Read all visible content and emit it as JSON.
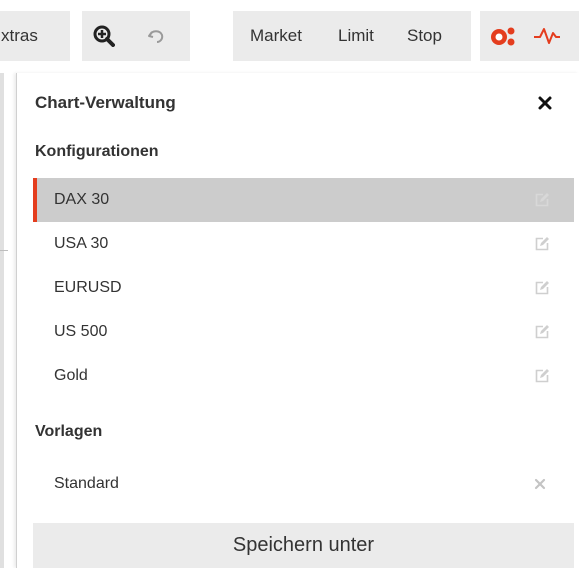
{
  "toolbar": {
    "extras_label": "xtras",
    "market_label": "Market",
    "limit_label": "Limit",
    "stop_label": "Stop"
  },
  "colors": {
    "accent": "#e43d1e",
    "selected_bg": "#cccccc",
    "toolbar_bg": "#ebebeb"
  },
  "panel": {
    "title": "Chart-Verwaltung",
    "configurations_heading": "Konfigurationen",
    "configurations": [
      {
        "label": "DAX 30",
        "selected": true
      },
      {
        "label": "USA 30"
      },
      {
        "label": "EURUSD"
      },
      {
        "label": "US 500"
      },
      {
        "label": "Gold"
      }
    ],
    "templates_heading": "Vorlagen",
    "templates": [
      {
        "label": "Standard"
      }
    ],
    "save_label": "Speichern unter"
  }
}
